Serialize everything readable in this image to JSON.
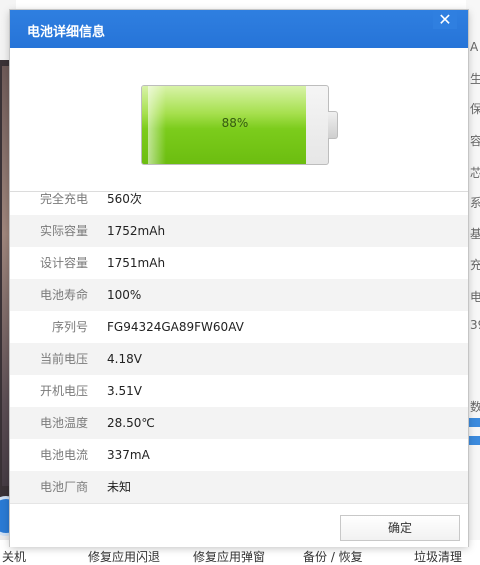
{
  "dialog": {
    "title": "电池详细信息",
    "close_symbol": "✕",
    "ok_label": "确定"
  },
  "battery": {
    "percent_text": "88%",
    "level": 0.88,
    "fill_color": "#7ccc1c"
  },
  "info": [
    {
      "label": "完全充电",
      "value": "560次"
    },
    {
      "label": "实际容量",
      "value": "1752mAh"
    },
    {
      "label": "设计容量",
      "value": "1751mAh"
    },
    {
      "label": "电池寿命",
      "value": "100%"
    },
    {
      "label": "序列号",
      "value": "FG94324GA89FW60AV"
    },
    {
      "label": "当前电压",
      "value": "4.18V"
    },
    {
      "label": "开机电压",
      "value": "3.51V"
    },
    {
      "label": "电池温度",
      "value": "28.50℃"
    },
    {
      "label": "电池电流",
      "value": "337mA"
    },
    {
      "label": "电池厂商",
      "value": "未知"
    }
  ],
  "background": {
    "right_chars": [
      "A",
      "生",
      "保",
      "容",
      "芯",
      "系",
      "基",
      "充",
      "电",
      "39",
      "数"
    ],
    "bottom_items": [
      "关机",
      "修复应用闪退",
      "修复应用弹窗",
      "备份 / 恢复",
      "垃圾清理"
    ]
  },
  "colors": {
    "titlebar": "#2674d8",
    "accent_bar": "#3c8bde"
  }
}
